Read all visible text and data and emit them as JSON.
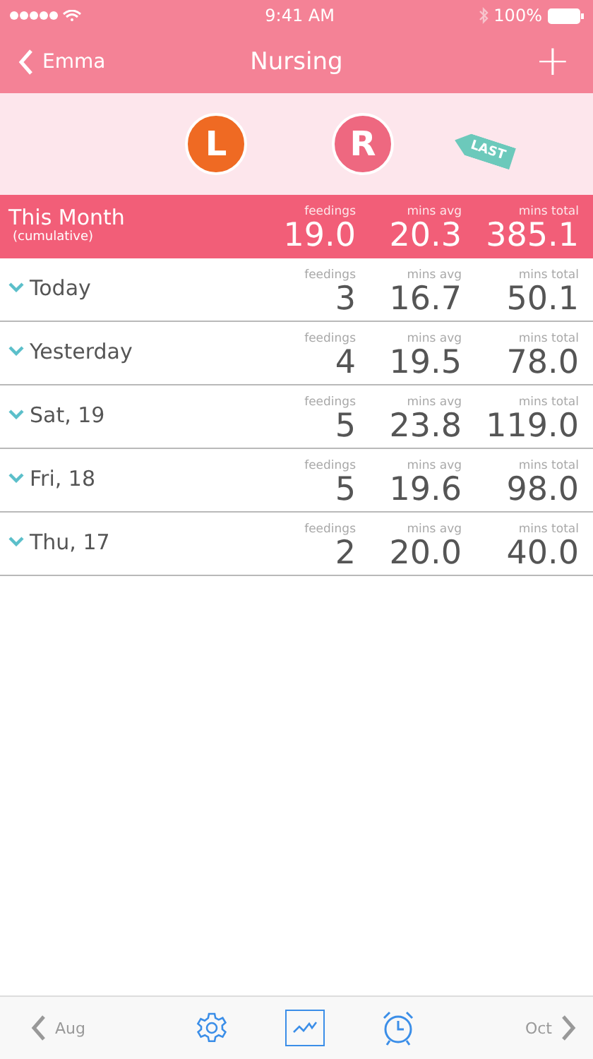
{
  "status_bar": {
    "time": "9:41 AM",
    "battery": "100%"
  },
  "nav": {
    "back": "Emma",
    "title": "Nursing",
    "add": "+"
  },
  "sides": {
    "left": "L",
    "right": "R",
    "last_badge": "LAST"
  },
  "summary": {
    "title": "This Month",
    "subtitle": "(cumulative)",
    "stats": [
      {
        "label": "feedings",
        "value": "19.0"
      },
      {
        "label": "mins avg",
        "value": "20.3"
      },
      {
        "label": "mins total",
        "value": "385.1"
      }
    ]
  },
  "days": [
    {
      "label": "Today",
      "stats": [
        {
          "label": "feedings",
          "value": "3"
        },
        {
          "label": "mins avg",
          "value": "16.7"
        },
        {
          "label": "mins total",
          "value": "50.1"
        }
      ]
    },
    {
      "label": "Yesterday",
      "stats": [
        {
          "label": "feedings",
          "value": "4"
        },
        {
          "label": "mins avg",
          "value": "19.5"
        },
        {
          "label": "mins total",
          "value": "78.0"
        }
      ]
    },
    {
      "label": "Sat, 19",
      "stats": [
        {
          "label": "feedings",
          "value": "5"
        },
        {
          "label": "mins avg",
          "value": "23.8"
        },
        {
          "label": "mins total",
          "value": "119.0"
        }
      ]
    },
    {
      "label": "Fri, 18",
      "stats": [
        {
          "label": "feedings",
          "value": "5"
        },
        {
          "label": "mins avg",
          "value": "19.6"
        },
        {
          "label": "mins total",
          "value": "98.0"
        }
      ]
    },
    {
      "label": "Thu, 17",
      "stats": [
        {
          "label": "feedings",
          "value": "2"
        },
        {
          "label": "mins avg",
          "value": "20.0"
        },
        {
          "label": "mins total",
          "value": "40.0"
        }
      ]
    }
  ],
  "toolbar": {
    "prev": "Aug",
    "next": "Oct",
    "tools": [
      {
        "kind": "settings",
        "selected": false
      },
      {
        "kind": "chart",
        "selected": true
      },
      {
        "kind": "alarm",
        "selected": false
      }
    ]
  }
}
